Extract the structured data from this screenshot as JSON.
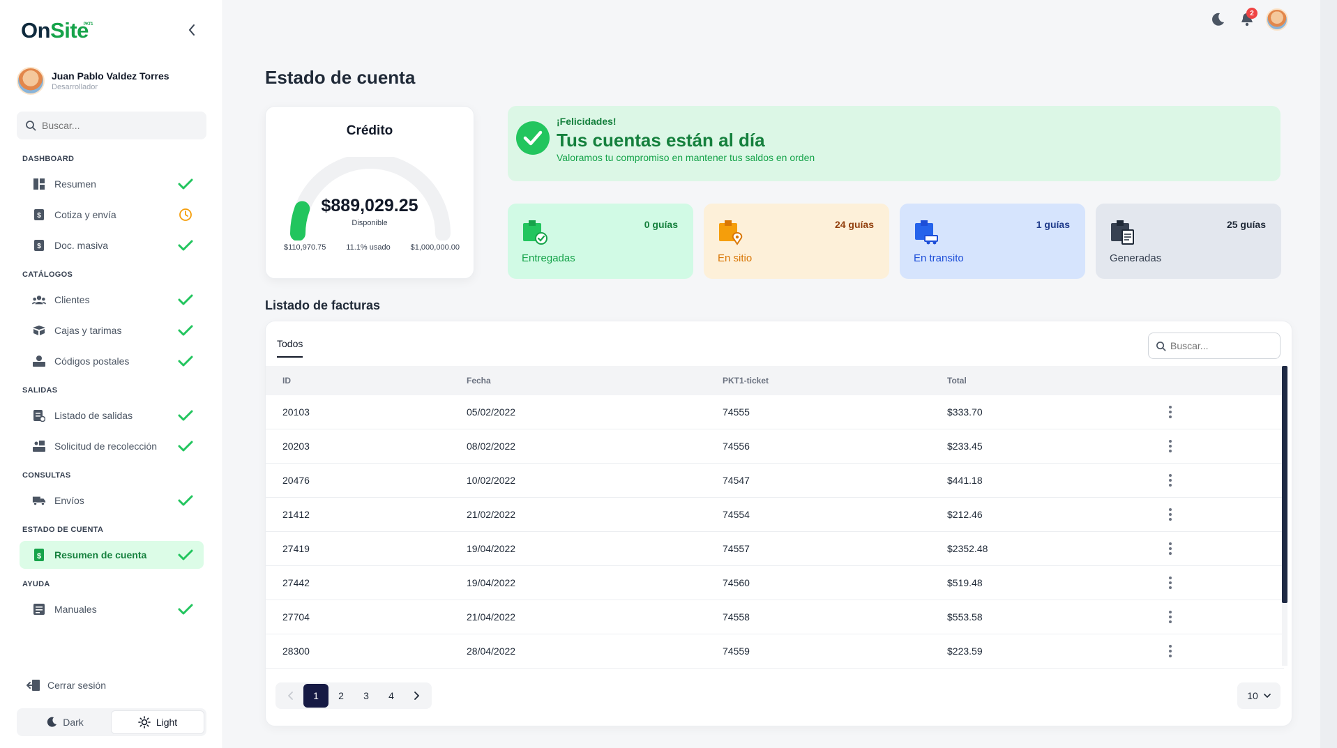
{
  "brand": {
    "name_a": "On",
    "name_b": "Site",
    "tag": "PKT1"
  },
  "user": {
    "name": "Juan Pablo Valdez Torres",
    "role": "Desarrollador"
  },
  "sidebar_search": {
    "placeholder": "Buscar..."
  },
  "sections": {
    "dashboard": "DASHBOARD",
    "catalogos": "CATÁLOGOS",
    "salidas": "SALIDAS",
    "consultas": "CONSULTAS",
    "estado": "ESTADO DE CUENTA",
    "ayuda": "AYUDA"
  },
  "nav": [
    {
      "label": "Resumen",
      "icon": "dashboard-icon",
      "status": "check"
    },
    {
      "label": "Cotiza y envía",
      "icon": "quote-icon",
      "status": "pending"
    },
    {
      "label": "Doc. masiva",
      "icon": "document-icon",
      "status": "check"
    },
    {
      "label": "Clientes",
      "icon": "users-icon",
      "status": "check"
    },
    {
      "label": "Cajas y tarimas",
      "icon": "boxes-icon",
      "status": "check"
    },
    {
      "label": "Códigos postales",
      "icon": "postal-icon",
      "status": "check"
    },
    {
      "label": "Listado de salidas",
      "icon": "list-icon",
      "status": "check"
    },
    {
      "label": "Solicitud de recolección",
      "icon": "pickup-icon",
      "status": "check"
    },
    {
      "label": "Envíos",
      "icon": "truck-icon",
      "status": "check"
    },
    {
      "label": "Resumen de cuenta",
      "icon": "invoice-icon",
      "status": "check"
    },
    {
      "label": "Manuales",
      "icon": "book-icon",
      "status": "check"
    }
  ],
  "logout": "Cerrar sesión",
  "theme": {
    "dark": "Dark",
    "light": "Light",
    "selected": "Light"
  },
  "notifications": {
    "count": "2"
  },
  "page_title": "Estado de cuenta",
  "credit": {
    "title": "Crédito",
    "amount": "$889,029.25",
    "available_label": "Disponible",
    "used_amount": "$110,970.75",
    "used_percent": "11.1% usado",
    "used_fraction": 0.111,
    "limit": "$1,000,000.00"
  },
  "congrats": {
    "small": "¡Felicidades!",
    "title": "Tus cuentas están al día",
    "subtitle": "Valoramos tu compromiso en mantener tus saldos en orden"
  },
  "stats": [
    {
      "count": "0 guías",
      "label": "Entregadas",
      "color": "#22c55e",
      "bg": "#d1fae5",
      "icon": "delivered-box-icon"
    },
    {
      "count": "24 guías",
      "label": "En sitio",
      "color": "#f59e0b",
      "bg": "#fdf0d9",
      "icon": "location-box-icon"
    },
    {
      "count": "1 guías",
      "label": "En transito",
      "color": "#2563eb",
      "bg": "#d6e4fd",
      "icon": "transit-box-icon"
    },
    {
      "count": "25 guías",
      "label": "Generadas",
      "color": "#374151",
      "bg": "#e3e7ee",
      "icon": "generated-box-icon"
    }
  ],
  "invoices": {
    "title": "Listado de facturas",
    "tab": "Todos",
    "search_placeholder": "Buscar...",
    "columns": [
      "ID",
      "Fecha",
      "PKT1-ticket",
      "Total"
    ],
    "rows": [
      [
        "20103",
        "05/02/2022",
        "74555",
        "$333.70"
      ],
      [
        "20203",
        "08/02/2022",
        "74556",
        "$233.45"
      ],
      [
        "20476",
        "10/02/2022",
        "74547",
        "$441.18"
      ],
      [
        "21412",
        "21/02/2022",
        "74554",
        "$212.46"
      ],
      [
        "27419",
        "19/04/2022",
        "74557",
        "$2352.48"
      ],
      [
        "27442",
        "19/04/2022",
        "74560",
        "$519.48"
      ],
      [
        "27704",
        "21/04/2022",
        "74558",
        "$553.58"
      ],
      [
        "28300",
        "28/04/2022",
        "74559",
        "$223.59"
      ]
    ],
    "pages": [
      "1",
      "2",
      "3",
      "4"
    ],
    "current_page": "1",
    "per_page": "10"
  },
  "colors": {
    "accent": "#22c55e",
    "pending": "#f59e0b",
    "nav_active_bg": "#dcfce7",
    "pager_active": "#161a44"
  }
}
